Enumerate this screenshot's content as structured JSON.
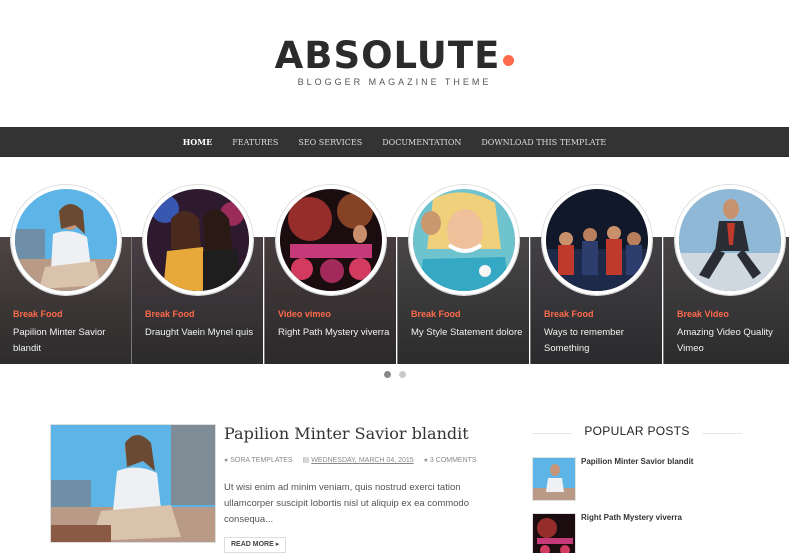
{
  "header": {
    "logo_text": "ABSOLUTE",
    "tagline": "BLOGGER MAGAZINE THEME",
    "accent_color": "#ff6a4b"
  },
  "nav": {
    "items": [
      {
        "label": "HOME"
      },
      {
        "label": "FEATURES"
      },
      {
        "label": "SEO SERVICES"
      },
      {
        "label": "DOCUMENTATION"
      },
      {
        "label": "DOWNLOAD THIS TEMPLATE"
      }
    ]
  },
  "slider": {
    "slides": [
      {
        "category": "Break  Food",
        "title": "Papilion Minter Savior blandit"
      },
      {
        "category": "Break  Food",
        "title": "Draught Vaein Mynel quis"
      },
      {
        "category": "Video  vimeo",
        "title": "Right Path Mystery viverra"
      },
      {
        "category": "Break  Food",
        "title": "My Style Statement dolore"
      },
      {
        "category": "Break  Food",
        "title": "Ways to remember Something"
      },
      {
        "category": "Break  Video",
        "title": "Amazing Video Quality Vimeo"
      }
    ],
    "active_dot": 1,
    "dot_count": 2
  },
  "post": {
    "title": "Papilion Minter Savior blandit",
    "author": "SORA TEMPLATES",
    "date": "WEDNESDAY, MARCH 04, 2015",
    "comments": "3 COMMENTS",
    "excerpt": "Ut wisi enim ad minim veniam, quis nostrud exerci tation ullamcorper suscipit lobortis nisl ut aliquip ex ea commodo consequa...",
    "read_more": "READ MORE"
  },
  "sidebar": {
    "heading": "POPULAR POSTS",
    "items": [
      {
        "title": "Papilion Minter Savior blandit"
      },
      {
        "title": "Right Path Mystery viverra"
      }
    ]
  }
}
